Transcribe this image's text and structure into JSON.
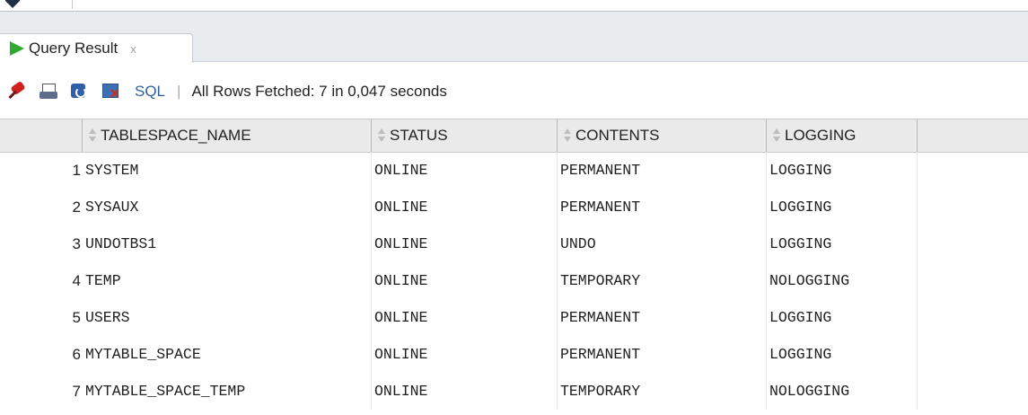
{
  "tab": {
    "label": "Query Result",
    "close": "x",
    "icon": "run-icon"
  },
  "toolbar": {
    "sql_label": "SQL",
    "separator": "|",
    "status": "All Rows Fetched: 7 in 0,047 seconds",
    "icons": [
      "pin-icon",
      "print-icon",
      "refresh-icon",
      "delete-icon"
    ]
  },
  "grid": {
    "columns": [
      "TABLESPACE_NAME",
      "STATUS",
      "CONTENTS",
      "LOGGING"
    ],
    "rows": [
      {
        "num": "1",
        "cells": [
          "SYSTEM",
          "ONLINE",
          "PERMANENT",
          "LOGGING"
        ]
      },
      {
        "num": "2",
        "cells": [
          "SYSAUX",
          "ONLINE",
          "PERMANENT",
          "LOGGING"
        ]
      },
      {
        "num": "3",
        "cells": [
          "UNDOTBS1",
          "ONLINE",
          "UNDO",
          "LOGGING"
        ]
      },
      {
        "num": "4",
        "cells": [
          "TEMP",
          "ONLINE",
          "TEMPORARY",
          "NOLOGGING"
        ]
      },
      {
        "num": "5",
        "cells": [
          "USERS",
          "ONLINE",
          "PERMANENT",
          "LOGGING"
        ]
      },
      {
        "num": "6",
        "cells": [
          "MYTABLE_SPACE",
          "ONLINE",
          "PERMANENT",
          "LOGGING"
        ]
      },
      {
        "num": "7",
        "cells": [
          "MYTABLE_SPACE_TEMP",
          "ONLINE",
          "TEMPORARY",
          "NOLOGGING"
        ]
      }
    ]
  },
  "colors": {
    "tab_strip": "#e9ecef",
    "header_bg": "#eaeaea",
    "run_icon": "#2fa92f",
    "sql_link": "#2f5f9e"
  }
}
